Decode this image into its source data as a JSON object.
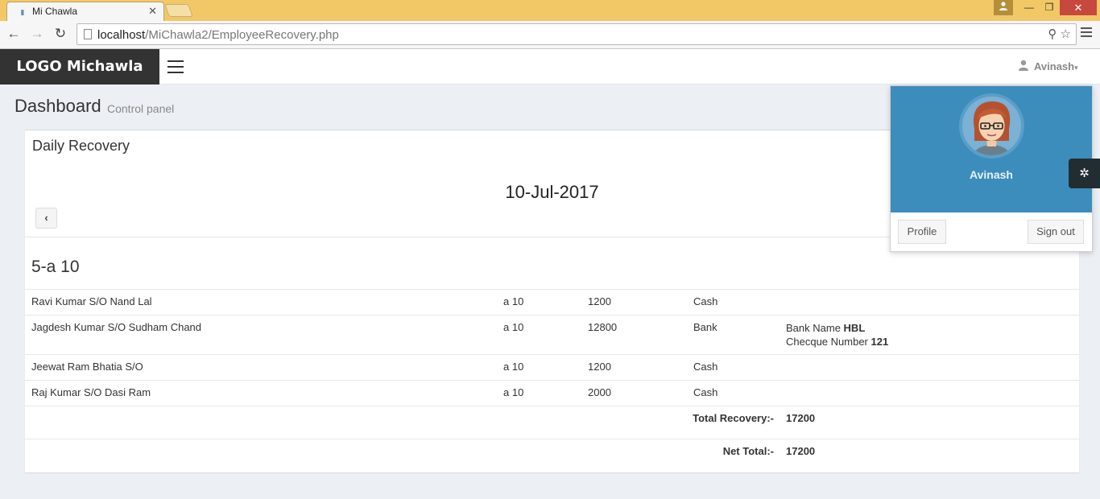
{
  "browser": {
    "tab_title": "Mi Chawla",
    "tab_close": "✕",
    "url_host": "localhost",
    "url_path": "/MiChawla2/EmployeeRecovery.php",
    "back": "←",
    "forward": "→",
    "reload": "↻",
    "win_minimize": "—",
    "win_restore": "❐",
    "win_close": "✕",
    "omni_icons": "⚲ ☆"
  },
  "header": {
    "logo": "LOGO Michawla",
    "user_name": "Avinash",
    "caret": "▾"
  },
  "page": {
    "title": "Dashboard",
    "subtitle": "Control panel"
  },
  "box": {
    "title": "Daily Recovery",
    "date": "10-Jul-2017",
    "prev_label": "‹",
    "group_title": "5-a 10"
  },
  "recoveries": [
    {
      "name": "Ravi Kumar S/O Nand Lal",
      "class": "a 10",
      "amount": "1200",
      "mode": "Cash"
    },
    {
      "name": "Jagdesh Kumar S/O Sudham Chand",
      "class": "a 10",
      "amount": "12800",
      "mode": "Bank",
      "bank_label": "Bank Name ",
      "bank_value": "HBL",
      "cheque_label": "Checque Number ",
      "cheque_value": "121"
    },
    {
      "name": "Jeewat Ram Bhatia S/O",
      "class": "a 10",
      "amount": "1200",
      "mode": "Cash"
    },
    {
      "name": "Raj Kumar S/O Dasi Ram",
      "class": "a 10",
      "amount": "2000",
      "mode": "Cash"
    }
  ],
  "totals": {
    "total_label": "Total Recovery:-",
    "total_value": "17200",
    "net_label": "Net Total:-",
    "net_value": "17200"
  },
  "dropdown": {
    "name": "Avinash",
    "profile_button": "Profile",
    "signout_button": "Sign out"
  },
  "gear_icon": "✲",
  "colors": {
    "accent": "#3c8dbc",
    "titlebar": "#f2c867",
    "logo_bg": "#333333"
  }
}
